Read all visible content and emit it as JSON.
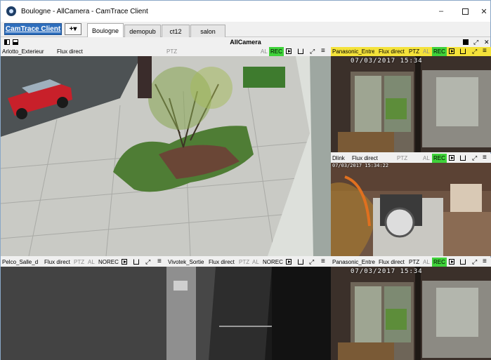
{
  "window": {
    "title": "Boulogne - AllCamera - CamTrace Client",
    "minimize_glyph": "–",
    "close_glyph": "✕"
  },
  "toolbar": {
    "brand_label": "CamTrace Client",
    "add_label": "+▾",
    "tabs": [
      {
        "label": "Boulogne",
        "active": true
      },
      {
        "label": "demopub",
        "active": false
      },
      {
        "label": "ct12",
        "active": false
      },
      {
        "label": "salon",
        "active": false
      }
    ]
  },
  "view": {
    "title": "AllCamera",
    "close_glyph": "✕",
    "expand_glyph": "⤢"
  },
  "cameras": [
    {
      "name": "Arlotto_Exterieur",
      "mode": "Flux direct",
      "ptz": "PTZ",
      "al": "AL",
      "rec": "REC",
      "rec_active": true,
      "timestamp": ""
    },
    {
      "name": "Panasonic_Entre",
      "mode": "Flux direct",
      "ptz": "PTZ",
      "al": "AL",
      "rec": "REC",
      "rec_active": true,
      "timestamp": "07/03/2017 15:34"
    },
    {
      "name": "Dlink",
      "mode": "Flux direct",
      "ptz": "PTZ",
      "al": "AL",
      "rec": "REC",
      "rec_active": true,
      "timestamp": "07/03/2017 15:34:22"
    },
    {
      "name": "Pelco_Salle_d",
      "mode": "Flux direct",
      "ptz": "PTZ",
      "al": "AL",
      "rec": "NOREC",
      "rec_active": false,
      "timestamp": ""
    },
    {
      "name": "Vivotek_Sortie",
      "mode": "Flux direct",
      "ptz": "PTZ",
      "al": "AL",
      "rec": "NOREC",
      "rec_active": false,
      "timestamp": ""
    },
    {
      "name": "Panasonic_Entre",
      "mode": "Flux direct",
      "ptz": "PTZ",
      "al": "AL",
      "rec": "REC",
      "rec_active": true,
      "timestamp": "07/03/2017 15:34"
    }
  ],
  "icons": {
    "play": "play-icon",
    "edit": "edit-icon",
    "expand": "expand-icon",
    "menu": "menu-icon",
    "expand_glyph": "⤢",
    "menu_glyph": "≡"
  }
}
